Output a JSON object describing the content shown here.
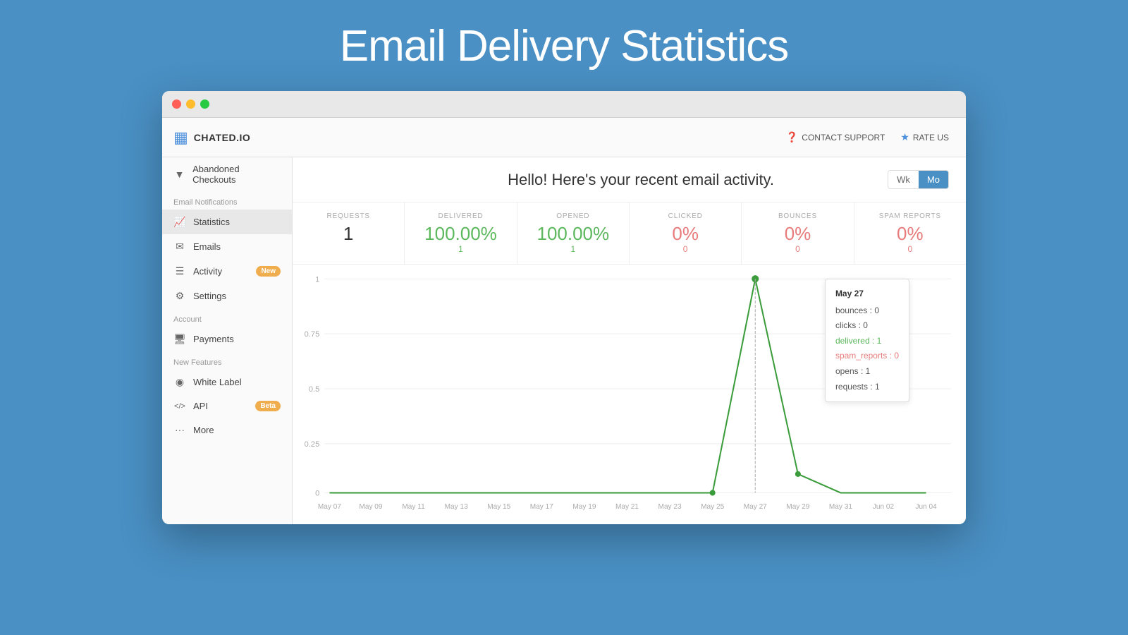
{
  "page": {
    "title": "Email Delivery Statistics",
    "bg_color": "#4a90c4"
  },
  "window": {
    "top_bar": {
      "logo_symbol": "▦",
      "logo_name": "CHATED.IO",
      "contact_support_label": "CONTACT SUPPORT",
      "rate_us_label": "RATE US"
    },
    "sidebar": {
      "top_link": "Abandoned Checkouts",
      "section_email": "Email Notifications",
      "items": [
        {
          "id": "statistics",
          "icon": "📈",
          "label": "Statistics",
          "active": true
        },
        {
          "id": "emails",
          "icon": "✉",
          "label": "Emails"
        },
        {
          "id": "activity",
          "icon": "☰",
          "label": "Activity",
          "badge": "New",
          "badge_type": "new"
        },
        {
          "id": "settings",
          "icon": "⚙",
          "label": "Settings"
        }
      ],
      "section_account": "Account",
      "account_items": [
        {
          "id": "payments",
          "icon": "💳",
          "label": "Payments"
        }
      ],
      "section_new_features": "New Features",
      "feature_items": [
        {
          "id": "white-label",
          "icon": "◉",
          "label": "White Label"
        },
        {
          "id": "api",
          "icon": "</>",
          "label": "API",
          "badge": "Beta",
          "badge_type": "beta"
        }
      ],
      "more_item": {
        "icon": "···",
        "label": "More"
      }
    },
    "main": {
      "header_title": "Hello! Here's your recent email activity.",
      "period_buttons": [
        {
          "label": "Wk",
          "active": false
        },
        {
          "label": "Mo",
          "active": true
        }
      ],
      "stats": [
        {
          "id": "requests",
          "label": "REQUESTS",
          "value": "1",
          "sub": "",
          "color": "default"
        },
        {
          "id": "delivered",
          "label": "DELIVERED",
          "value": "100.00%",
          "sub": "1",
          "color": "green"
        },
        {
          "id": "opened",
          "label": "OPENED",
          "value": "100.00%",
          "sub": "1",
          "color": "green"
        },
        {
          "id": "clicked",
          "label": "CLICKED",
          "value": "0%",
          "sub": "0",
          "color": "pink"
        },
        {
          "id": "bounces",
          "label": "BOUNCES",
          "value": "0%",
          "sub": "0",
          "color": "pink"
        },
        {
          "id": "spam_reports",
          "label": "SPAM REPORTS",
          "value": "0%",
          "sub": "0",
          "color": "pink"
        }
      ],
      "chart": {
        "y_labels": [
          "1",
          "0.75",
          "0.5",
          "0.25",
          "0"
        ],
        "x_labels": [
          "May 07",
          "May 09",
          "May 11",
          "May 13",
          "May 15",
          "May 17",
          "May 19",
          "May 21",
          "May 23",
          "May 25",
          "May 27",
          "May 29",
          "May 31",
          "Jun 02",
          "Jun 04"
        ]
      },
      "tooltip": {
        "date": "May 27",
        "rows": [
          {
            "key": "bounces",
            "value": "0",
            "color": "default"
          },
          {
            "key": "clicks",
            "value": "0",
            "color": "default"
          },
          {
            "key": "delivered",
            "value": "1",
            "color": "green"
          },
          {
            "key": "spam_reports",
            "value": "0",
            "color": "pink"
          },
          {
            "key": "opens",
            "value": "1",
            "color": "default"
          },
          {
            "key": "requests",
            "value": "1",
            "color": "default"
          }
        ]
      }
    }
  }
}
